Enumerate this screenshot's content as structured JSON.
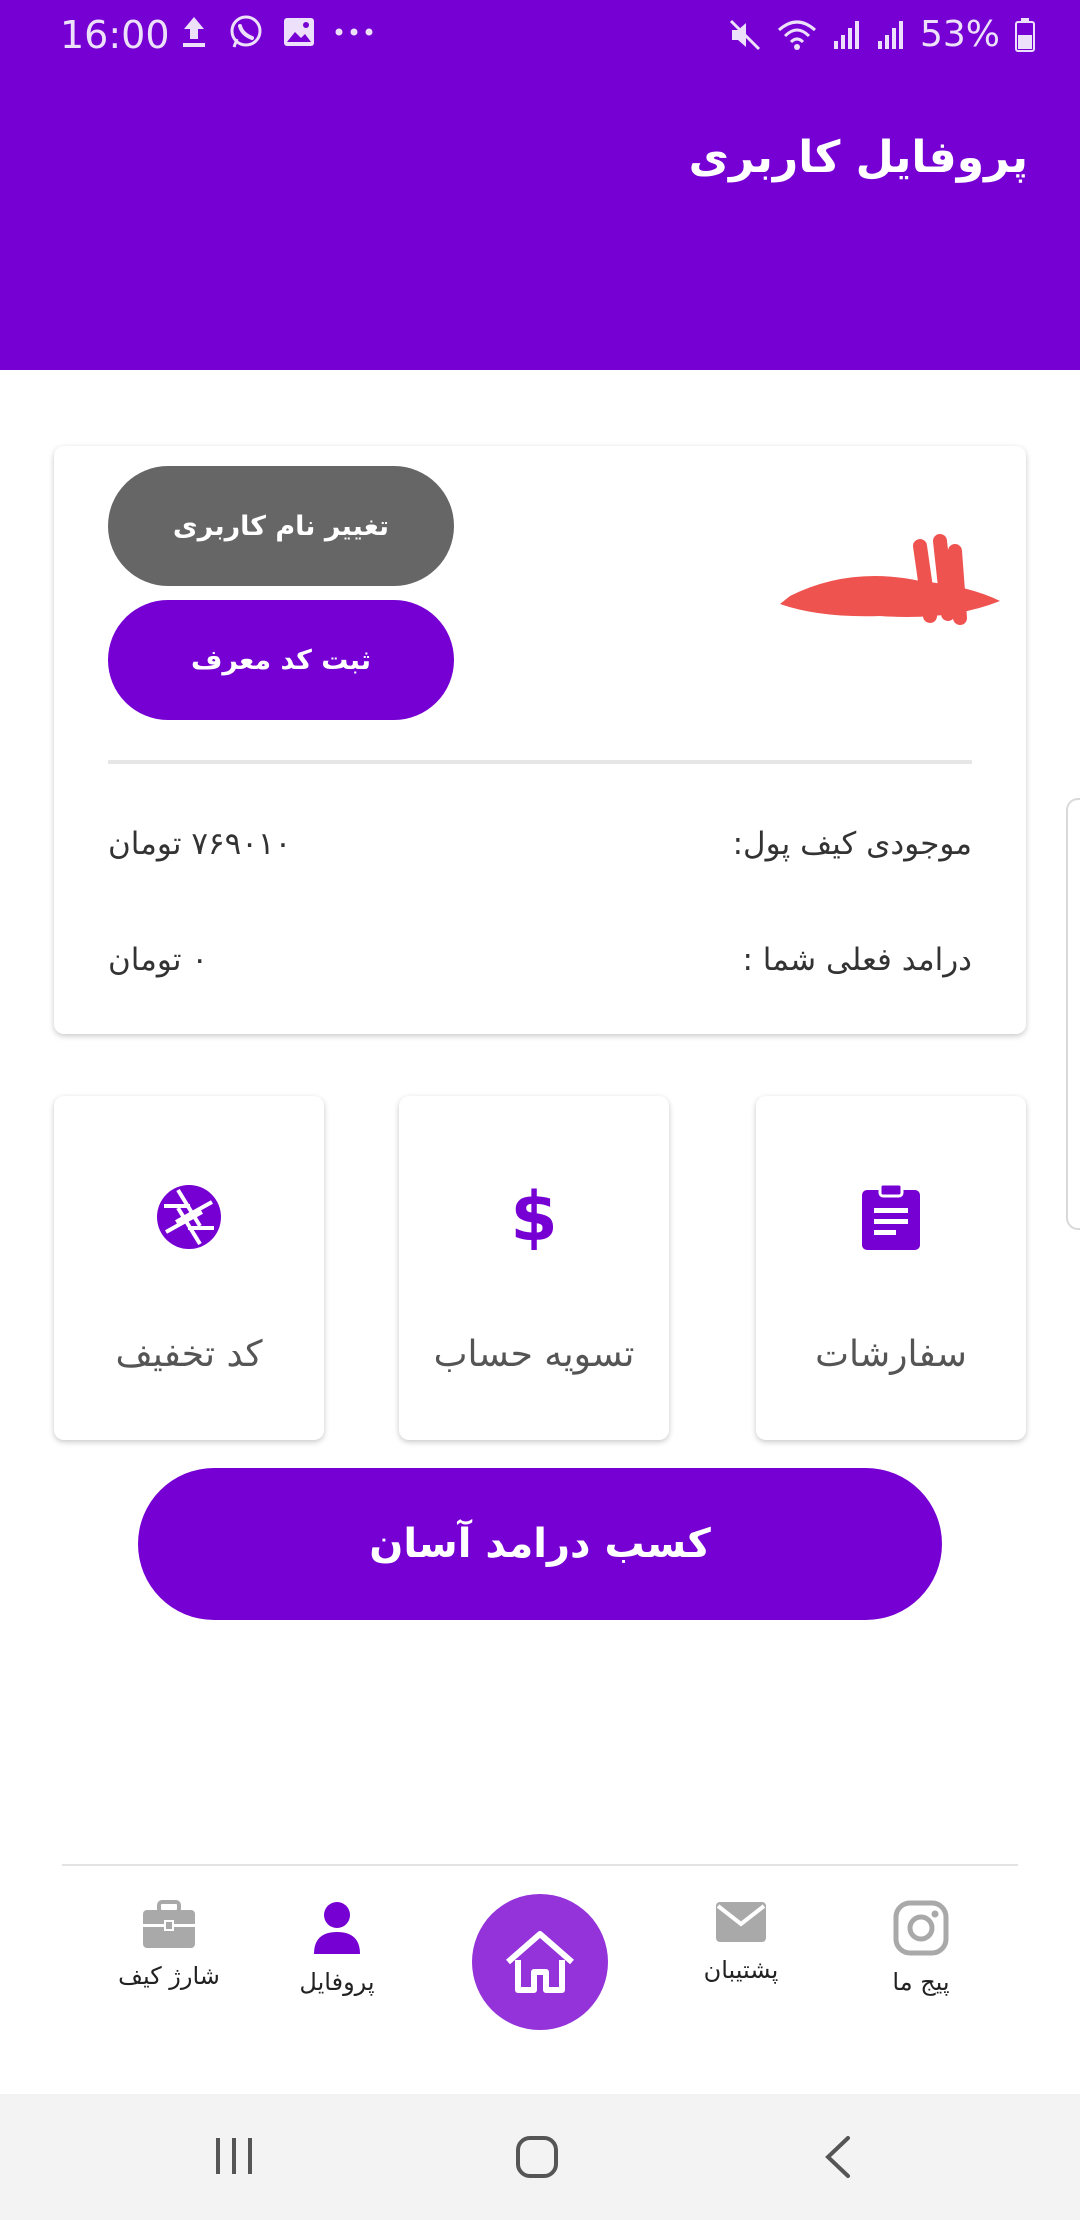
{
  "status_bar": {
    "time": "16:00",
    "battery": "53%",
    "left_icons": [
      "upload-icon",
      "whatsapp-icon",
      "image-icon",
      "more-icon"
    ],
    "right_icons": [
      "mute-icon",
      "wifi-icon",
      "signal-icon",
      "signal-icon",
      "battery-icon"
    ]
  },
  "header": {
    "title": "پروفایل کاربری"
  },
  "profile_card": {
    "change_username_label": "تغییر نام کاربری",
    "register_referral_label": "ثبت کد معرف",
    "wallet_label": "موجودی کیف پول:",
    "wallet_value": "۷۶۹۰۱۰ تومان",
    "income_label": "درامد فعلی شما :",
    "income_value": "۰ تومان"
  },
  "tiles": {
    "discount_label": "کد تخفیف",
    "settlement_label": "تسویه حساب",
    "settlement_symbol": "$",
    "orders_label": "سفارشات"
  },
  "cta_label": "کسب درامد آسان",
  "bottom_nav": {
    "charge_wallet": "شارژ کیف",
    "profile": "پروفایل",
    "support": "پشتیبان",
    "our_page": "پیج ما"
  },
  "colors": {
    "primary": "#7600d4",
    "home_button": "#9433d9",
    "gray_button": "#666666",
    "redaction": "#ef5350"
  }
}
